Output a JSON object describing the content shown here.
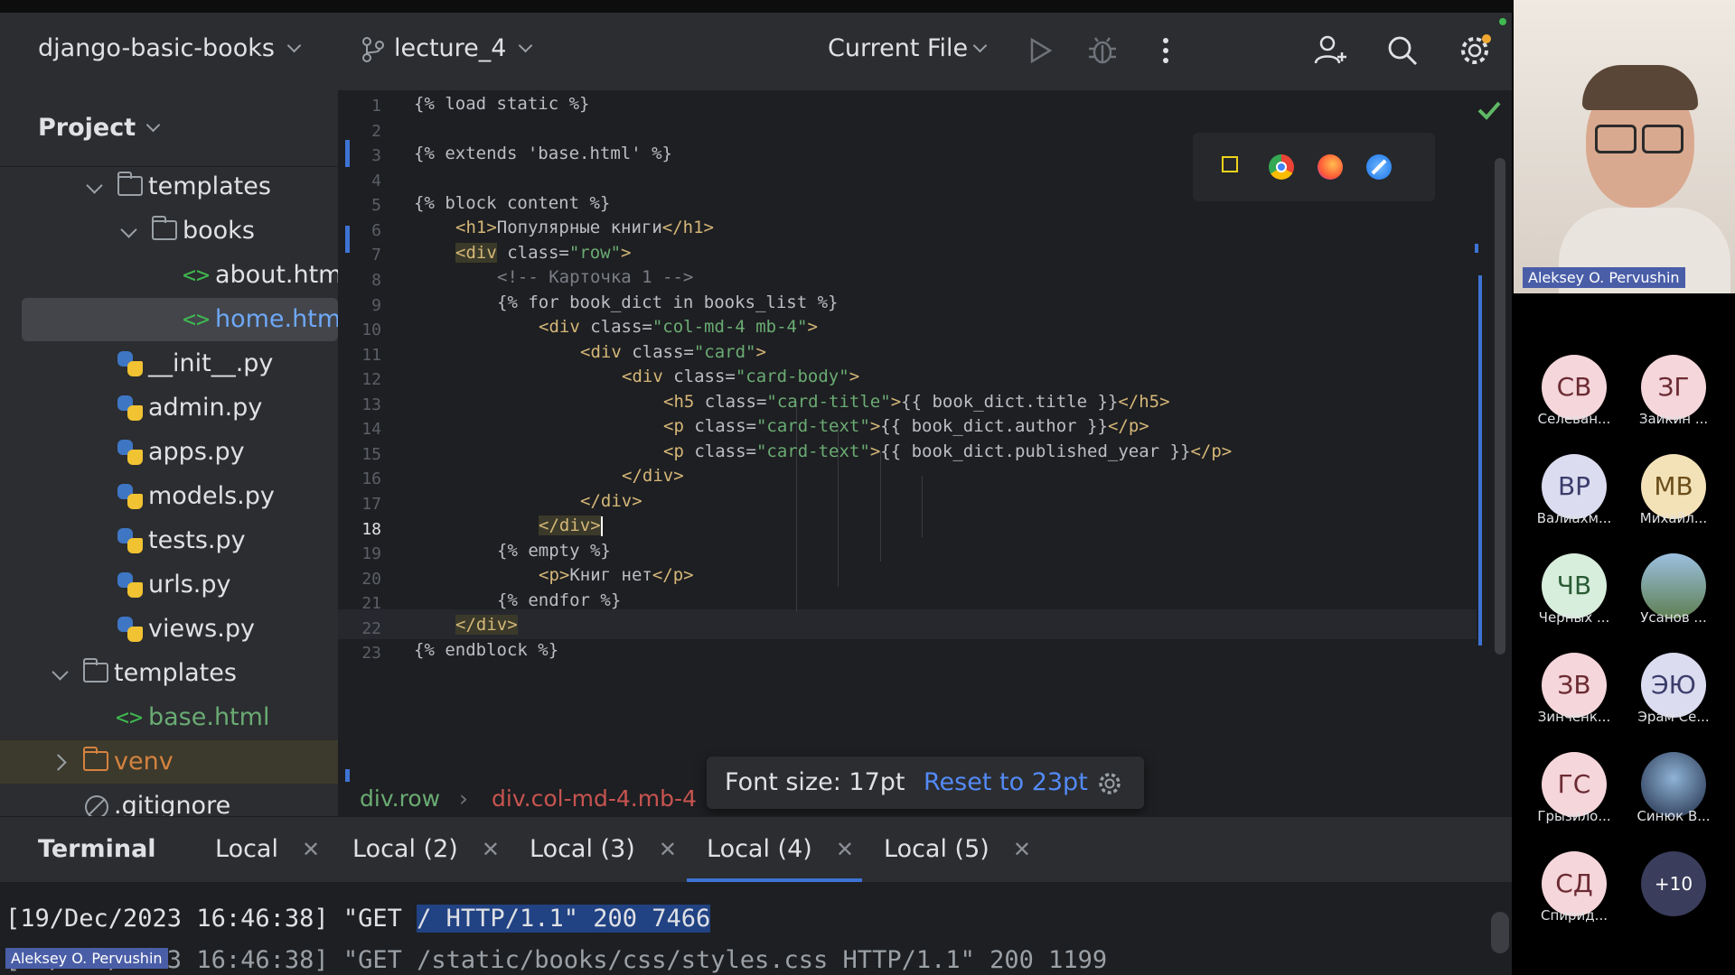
{
  "toolbar": {
    "project_name": "django-basic-books",
    "branch": "lecture_4",
    "run_config": "Current File"
  },
  "project_panel": {
    "title": "Project",
    "tree": [
      {
        "label": "templates",
        "kind": "folder"
      },
      {
        "label": "books",
        "kind": "folder"
      },
      {
        "label": "about.html",
        "kind": "html"
      },
      {
        "label": "home.html",
        "kind": "html",
        "selected": true
      },
      {
        "label": "__init__.py",
        "kind": "py"
      },
      {
        "label": "admin.py",
        "kind": "py"
      },
      {
        "label": "apps.py",
        "kind": "py"
      },
      {
        "label": "models.py",
        "kind": "py"
      },
      {
        "label": "tests.py",
        "kind": "py"
      },
      {
        "label": "urls.py",
        "kind": "py"
      },
      {
        "label": "views.py",
        "kind": "py"
      },
      {
        "label": "templates",
        "kind": "folder"
      },
      {
        "label": "base.html",
        "kind": "html"
      },
      {
        "label": "venv",
        "kind": "folder-excluded"
      },
      {
        "label": ".gitignore",
        "kind": "file"
      }
    ]
  },
  "editor": {
    "line_numbers": [
      "1",
      "2",
      "3",
      "4",
      "5",
      "6",
      "7",
      "8",
      "9",
      "10",
      "11",
      "12",
      "13",
      "14",
      "15",
      "16",
      "17",
      "18",
      "19",
      "20",
      "21",
      "22",
      "23"
    ],
    "current_line": "18",
    "code": {
      "l1": "{% load static %}",
      "l3": "{% extends 'base.html' %}",
      "l5": "{% block content %}",
      "l6_tag_open": "<h1>",
      "l6_text": "Популярные книги",
      "l6_tag_close": "</h1>",
      "l7_tag": "<div",
      "l7_attr": " class=",
      "l7_val": "\"row\"",
      "l7_end": ">",
      "l8": "<!-- Карточка 1 -->",
      "l9": "{% for book_dict in books_list %}",
      "l10_tag": "<div",
      "l10_attr": " class=",
      "l10_val": "\"col-md-4 mb-4\"",
      "l10_end": ">",
      "l11_tag": "<div",
      "l11_attr": " class=",
      "l11_val": "\"card\"",
      "l11_end": ">",
      "l12_tag": "<div",
      "l12_attr": " class=",
      "l12_val": "\"card-body\"",
      "l12_end": ">",
      "l13_tag": "<h5",
      "l13_attr": " class=",
      "l13_val": "\"card-title\"",
      "l13_gt": ">",
      "l13_text": "{{ book_dict.title }}",
      "l13_close": "</h5>",
      "l14_tag": "<p",
      "l14_attr": " class=",
      "l14_val": "\"card-text\"",
      "l14_gt": ">",
      "l14_text": "{{ book_dict.author }}",
      "l14_close": "</p>",
      "l15_tag": "<p",
      "l15_attr": " class=",
      "l15_val": "\"card-text\"",
      "l15_gt": ">",
      "l15_text": "{{ book_dict.published_year }}",
      "l15_close": "</p>",
      "l16": "</div>",
      "l17": "</div>",
      "l18": "</div>",
      "l19": "{% empty %}",
      "l20_open": "<p>",
      "l20_text": "Книг нет",
      "l20_close": "</p>",
      "l21": "{% endfor %}",
      "l22": "</div>",
      "l23": "{% endblock %}"
    },
    "breadcrumb": [
      "div.row",
      "div.col-md-4.mb-4"
    ],
    "font_popup": {
      "text": "Font size: 17pt",
      "reset": "Reset to 23pt"
    }
  },
  "terminal": {
    "title": "Terminal",
    "tabs": [
      "Local",
      "Local (2)",
      "Local (3)",
      "Local (4)",
      "Local (5)"
    ],
    "active_tab": "Local (4)",
    "line1_prefix": "[19/Dec/2023 16:46:38] \"GET ",
    "line1_selected": "/ HTTP/1.1\" 200 7466",
    "line2": "[19/Dec/2023 16:46:38] \"GET /static/books/css/styles.css HTTP/1.1\" 200 1199"
  },
  "meeting": {
    "speaker": "Aleksey O. Pervushin",
    "participants": [
      {
        "initials": "СВ",
        "name": "Селеван...",
        "color": "#f5d6da"
      },
      {
        "initials": "ЗГ",
        "name": "Заикин ...",
        "color": "#f5d6da"
      },
      {
        "initials": "ВР",
        "name": "Валиахм...",
        "color": "#dcdcf0"
      },
      {
        "initials": "МВ",
        "name": "Михайл...",
        "color": "#f3e2b8"
      },
      {
        "initials": "ЧВ",
        "name": "Черных ...",
        "color": "#d8eedc"
      },
      {
        "initials": "",
        "name": "Усанов ...",
        "color": "#7a9ab8"
      },
      {
        "initials": "ЗВ",
        "name": "Зинченк...",
        "color": "#f5d6da"
      },
      {
        "initials": "ЭЮ",
        "name": "Эрам Се...",
        "color": "#dcdcf0"
      },
      {
        "initials": "ГС",
        "name": "Грызило...",
        "color": "#f5d6da"
      },
      {
        "initials": "",
        "name": "Синюк В...",
        "color": "#3a4a6a"
      },
      {
        "initials": "СД",
        "name": "Спирид...",
        "color": "#f5d6da"
      },
      {
        "initials": "+10",
        "name": "",
        "color": "#3a3d5c"
      }
    ]
  }
}
